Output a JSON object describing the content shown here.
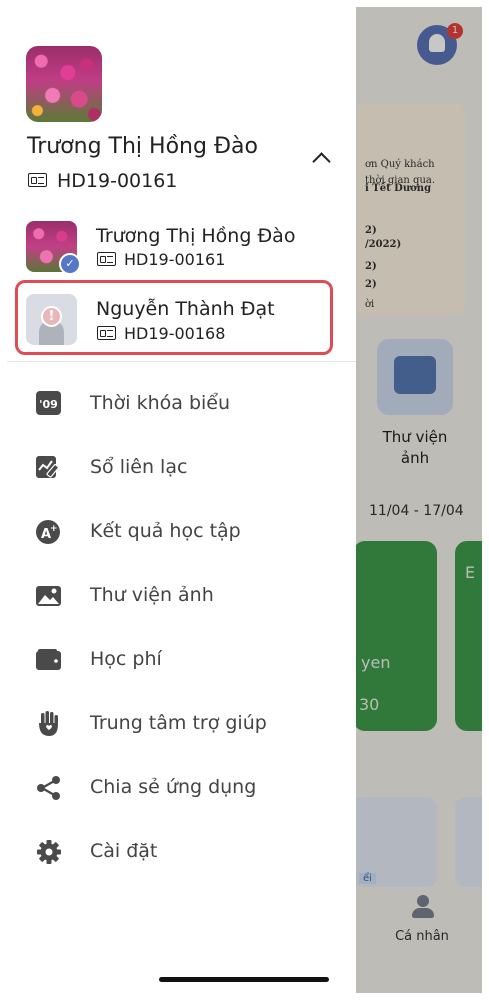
{
  "background": {
    "bell_badge": "1",
    "news_lines": [
      "ơn Quý khách",
      "thời gian qua.",
      "i Tết Dương",
      "2)",
      "/2022)",
      "2)",
      "2)",
      "ời"
    ],
    "tile_label": "Thư viện ảnh",
    "date_range": "11/04 - 17/04",
    "card_text_1": "yen",
    "card_text_2": "30",
    "card_text_3": "E",
    "bottom_tab_label": "Cá nhân",
    "badge_text": "ểi"
  },
  "profile": {
    "name": "Trương Thị Hồng Đào",
    "code": "HD19-00161"
  },
  "accounts": [
    {
      "name": "Trương Thị Hồng Đào",
      "code": "HD19-00161",
      "active": true
    },
    {
      "name": "Nguyễn Thành Đạt",
      "code": "HD19-00168",
      "active": false
    }
  ],
  "menu": [
    {
      "label": "Thời khóa biểu",
      "icon": "calendar-09-icon",
      "icon_glyph": "'09"
    },
    {
      "label": "Sổ liên lạc",
      "icon": "contact-book-icon"
    },
    {
      "label": "Kết quả học tập",
      "icon": "grade-result-icon"
    },
    {
      "label": "Thư viện ảnh",
      "icon": "photo-gallery-icon"
    },
    {
      "label": "Học phí",
      "icon": "wallet-icon"
    },
    {
      "label": "Trung tâm trợ giúp",
      "icon": "help-hand-icon"
    },
    {
      "label": "Chia sẻ ứng dụng",
      "icon": "share-icon"
    },
    {
      "label": "Cài đặt",
      "icon": "settings-gear-icon"
    }
  ]
}
